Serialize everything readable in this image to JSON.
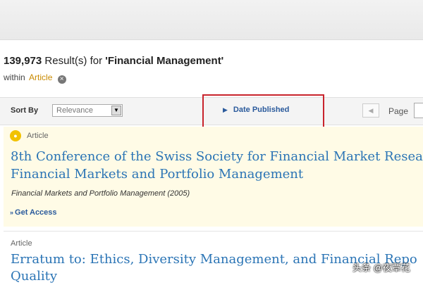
{
  "search": {
    "count": "139,973",
    "results_text": " Result(s) for ",
    "query": "'Financial Management'",
    "within_text": "within",
    "within_facet": "Article",
    "remove_icon": "×"
  },
  "sortbar": {
    "sort_by_label": "Sort By",
    "sort_value": "Relevance",
    "sort_arrow": "▼",
    "date_published_label": "Date Published",
    "date_published_icon": "▶",
    "prev_icon": "◀",
    "page_label": "Page"
  },
  "results": [
    {
      "type": "Article",
      "lock_icon": "●",
      "title_line1": "8th Conference of the Swiss Society for Financial Market Resea",
      "title_line2": "Financial Markets and Portfolio Management",
      "source": "Financial Markets and Portfolio Management (2005)",
      "access_icon": "»",
      "access_label": "Get Access"
    },
    {
      "type": "Article",
      "title_line1": "Erratum to: Ethics, Diversity Management, and Financial Repo",
      "title_line2": "Quality"
    }
  ],
  "watermark": "头条 @夜覃花",
  "colors": {
    "accent": "#2a74b5",
    "highlight_border": "#c8232c",
    "result_highlight_bg": "#fffbe6",
    "facet": "#c98a00"
  }
}
